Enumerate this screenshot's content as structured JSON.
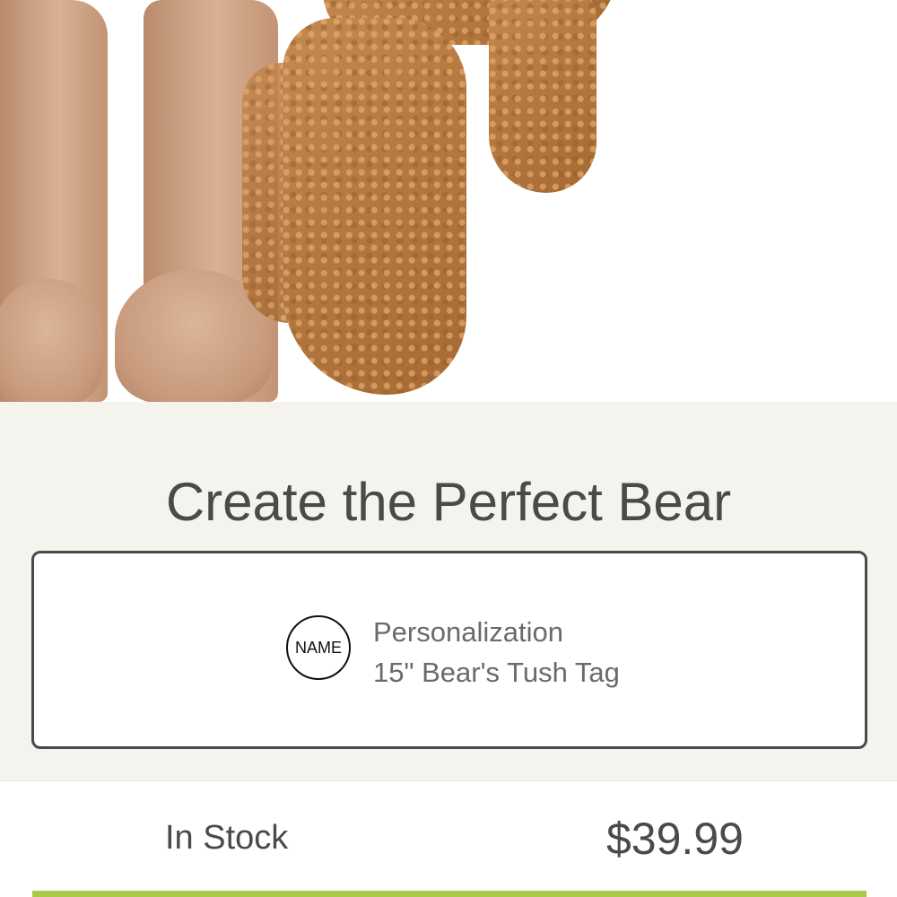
{
  "section": {
    "title": "Create the Perfect Bear"
  },
  "option": {
    "badge_text": "NAME",
    "title": "Personalization",
    "subtitle": "15\" Bear's Tush Tag"
  },
  "purchase": {
    "stock_status": "In Stock",
    "price": "$39.99"
  },
  "colors": {
    "accent": "#a8c94a",
    "text": "#4a4a4a",
    "section_background": "#f5f3ee"
  }
}
